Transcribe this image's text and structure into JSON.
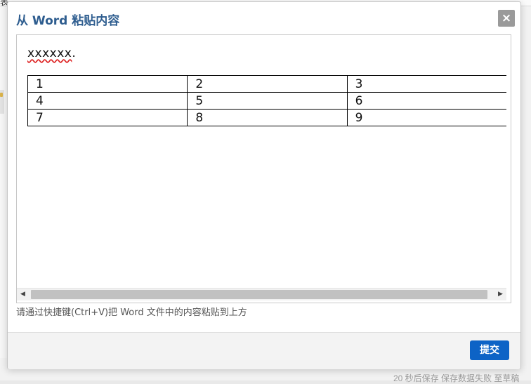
{
  "background": {
    "topbar_text": "表",
    "bottom_text": "20 秒后保存  保存数据失败 至草稿"
  },
  "modal": {
    "title": "从 Word 粘贴内容",
    "close_icon": "×",
    "editor": {
      "paragraph": "xxxxxx",
      "paragraph_suffix": ".",
      "table": {
        "rows": [
          [
            "1",
            "2",
            "3"
          ],
          [
            "4",
            "5",
            "6"
          ],
          [
            "7",
            "8",
            "9"
          ]
        ]
      },
      "scroll_left_icon": "◀",
      "scroll_right_icon": "▶"
    },
    "hint": "请通过快捷键(Ctrl+V)把 Word 文件中的内容粘贴到上方",
    "submit_label": "提交"
  },
  "colors": {
    "title": "#2e5d8f",
    "submit_button": "#0d63c6",
    "close_button": "#9a9a9a"
  }
}
